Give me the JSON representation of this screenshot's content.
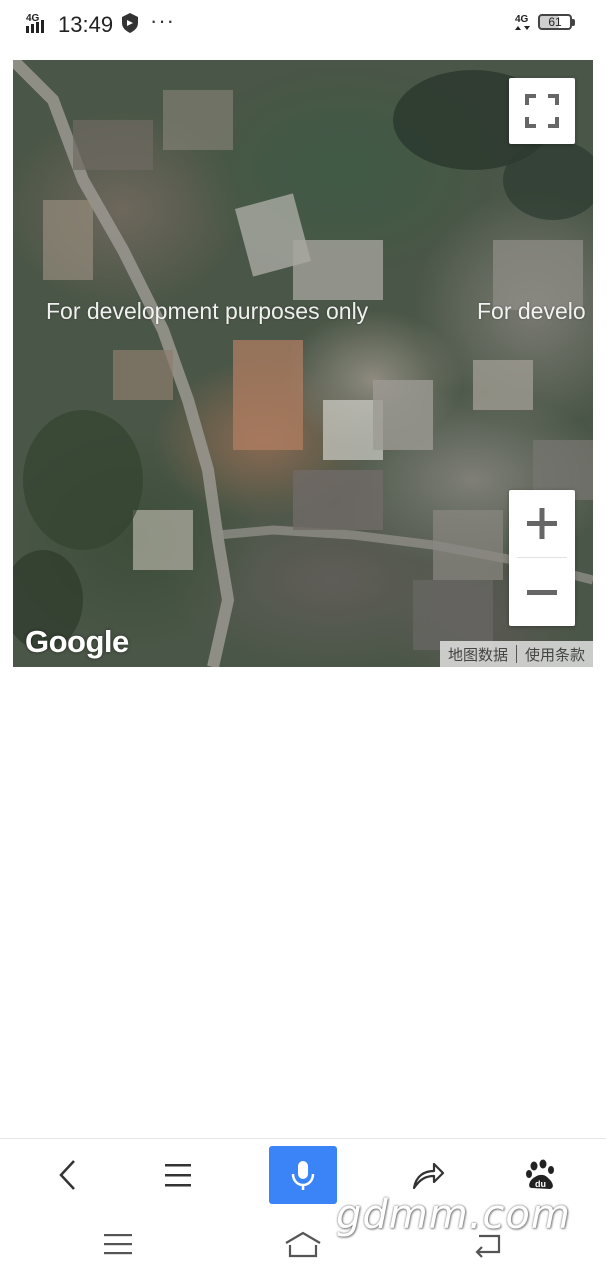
{
  "status_bar": {
    "network_left": "4G",
    "time": "13:49",
    "more": "···",
    "network_right": "4G",
    "battery_level": 61,
    "battery_text": "61"
  },
  "map": {
    "dev_notice_1": "For development purposes only",
    "dev_notice_2": "For develo",
    "zoom_in_icon": "plus-icon",
    "zoom_out_icon": "minus-icon",
    "fullscreen_icon": "fullscreen-icon",
    "logo": "Google",
    "map_data_link": "地图数据",
    "terms_link": "使用条款"
  },
  "toolbar": {
    "items": [
      {
        "name": "back",
        "icon": "chevron-left-icon"
      },
      {
        "name": "menu",
        "icon": "hamburger-icon"
      },
      {
        "name": "voice",
        "icon": "microphone-icon"
      },
      {
        "name": "share",
        "icon": "share-arrow-icon"
      },
      {
        "name": "baidu",
        "icon": "baidu-paw-icon"
      }
    ],
    "voice_color": "#3a84f7"
  },
  "nav_bar": {
    "items": [
      {
        "name": "menu",
        "icon": "menu-icon"
      },
      {
        "name": "home",
        "icon": "home-icon"
      },
      {
        "name": "back",
        "icon": "back-icon"
      }
    ]
  },
  "watermark": "gdmm.com"
}
